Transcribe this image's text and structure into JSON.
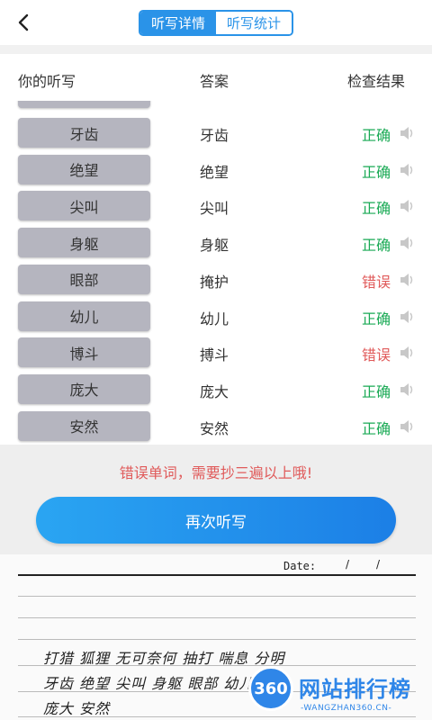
{
  "header": {
    "tabs": [
      {
        "label": "听写详情",
        "active": true
      },
      {
        "label": "听写统计",
        "active": false
      }
    ]
  },
  "columns": {
    "yours": "你的听写",
    "answer": "答案",
    "result": "检查结果"
  },
  "rows": [
    {
      "word": "牙齿",
      "answer": "牙齿",
      "result": "正确",
      "status": "ok"
    },
    {
      "word": "绝望",
      "answer": "绝望",
      "result": "正确",
      "status": "ok"
    },
    {
      "word": "尖叫",
      "answer": "尖叫",
      "result": "正确",
      "status": "ok"
    },
    {
      "word": "身躯",
      "answer": "身躯",
      "result": "正确",
      "status": "ok"
    },
    {
      "word": "眼部",
      "answer": "掩护",
      "result": "错误",
      "status": "bad"
    },
    {
      "word": "幼儿",
      "answer": "幼儿",
      "result": "正确",
      "status": "ok"
    },
    {
      "word": "博斗",
      "answer": "搏斗",
      "result": "错误",
      "status": "bad"
    },
    {
      "word": "庞大",
      "answer": "庞大",
      "result": "正确",
      "status": "ok"
    },
    {
      "word": "安然",
      "answer": "安然",
      "result": "正确",
      "status": "ok"
    }
  ],
  "notice": "错误单词，需要抄三遍以上哦!",
  "again_button": "再次听写",
  "paper": {
    "date_label": "Date:",
    "date_sep1": "/",
    "date_sep2": "/",
    "handwriting": [
      "打猎  狐狸  无可奈何  抽打  喘息  分明",
      "牙齿  绝望  尖叫  身躯  眼部  幼儿  博斗",
      "庞大  安然"
    ]
  },
  "watermark": {
    "badge": "360",
    "title": "网站排行榜",
    "url": "-WANGZHAN360.CN-"
  },
  "colors": {
    "accent": "#2a93e8",
    "correct": "#1aaa55",
    "wrong": "#e05a5a",
    "word_button": "#b5b5bf"
  }
}
